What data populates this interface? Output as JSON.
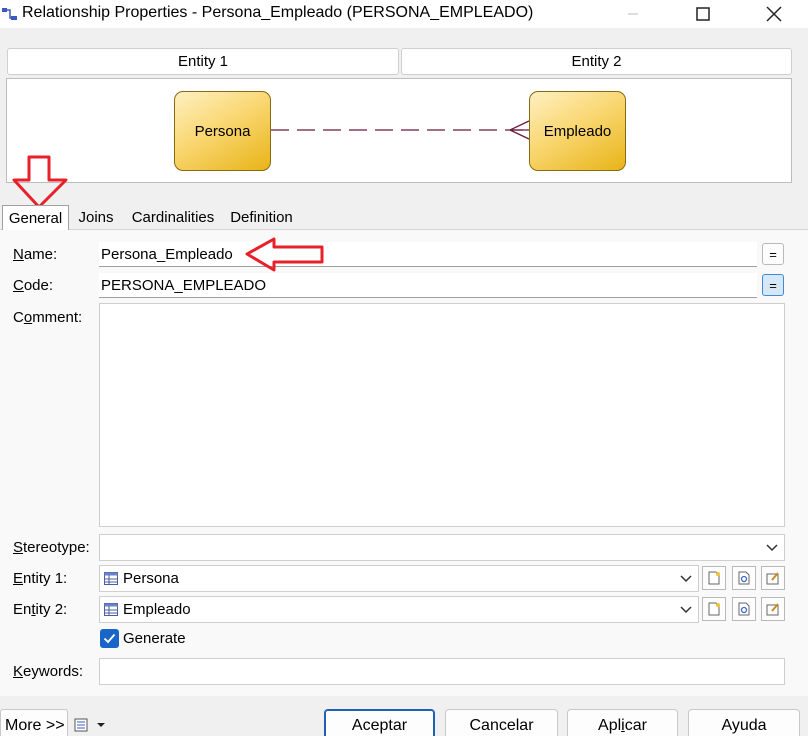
{
  "window": {
    "title": "Relationship Properties - Persona_Empleado (PERSONA_EMPLEADO)",
    "minimize_glyph": "—",
    "maximize_glyph": "☐",
    "close_glyph": "✕"
  },
  "entity_headers": [
    "Entity 1",
    "Entity 2"
  ],
  "diagram": {
    "entity1": "Persona",
    "entity2": "Empleado"
  },
  "tabs": [
    {
      "label": "General",
      "active": true
    },
    {
      "label": "Joins",
      "active": false
    },
    {
      "label": "Cardinalities",
      "active": false
    },
    {
      "label": "Definition",
      "active": false
    }
  ],
  "form": {
    "name": {
      "prefix": "N",
      "rest": "ame:",
      "value": "Persona_Empleado"
    },
    "code": {
      "prefix": "C",
      "rest": "ode:",
      "value": "PERSONA_EMPLEADO"
    },
    "comment": {
      "prefix": "C",
      "underline": "o",
      "rest": "mment:",
      "value": ""
    },
    "stereotype": {
      "label_a": "S",
      "label_b": "tereotype:",
      "value": ""
    },
    "entity1": {
      "label_a": "E",
      "label_b": "ntity 1:",
      "value": "Persona"
    },
    "entity2": {
      "label_a": "En",
      "label_u": "t",
      "label_b": "ity 2:",
      "value": "Empleado"
    },
    "generate": {
      "label": "Generate",
      "checked": true
    },
    "keywords": {
      "label_a": "K",
      "label_b": "eywords:",
      "value": ""
    },
    "eq_glyph": "="
  },
  "buttons": {
    "more": "More >>",
    "aceptar": "Aceptar",
    "cancelar": "Cancelar",
    "aplicar_a": "Apl",
    "aplicar_u": "i",
    "aplicar_b": "car",
    "ayuda": "Ayuda"
  },
  "colors": {
    "annotation_red": "#e8202a",
    "relationship_line": "#6b1a3c",
    "checkbox_blue": "#1a66c8",
    "entity_fill": "#f9d772"
  }
}
